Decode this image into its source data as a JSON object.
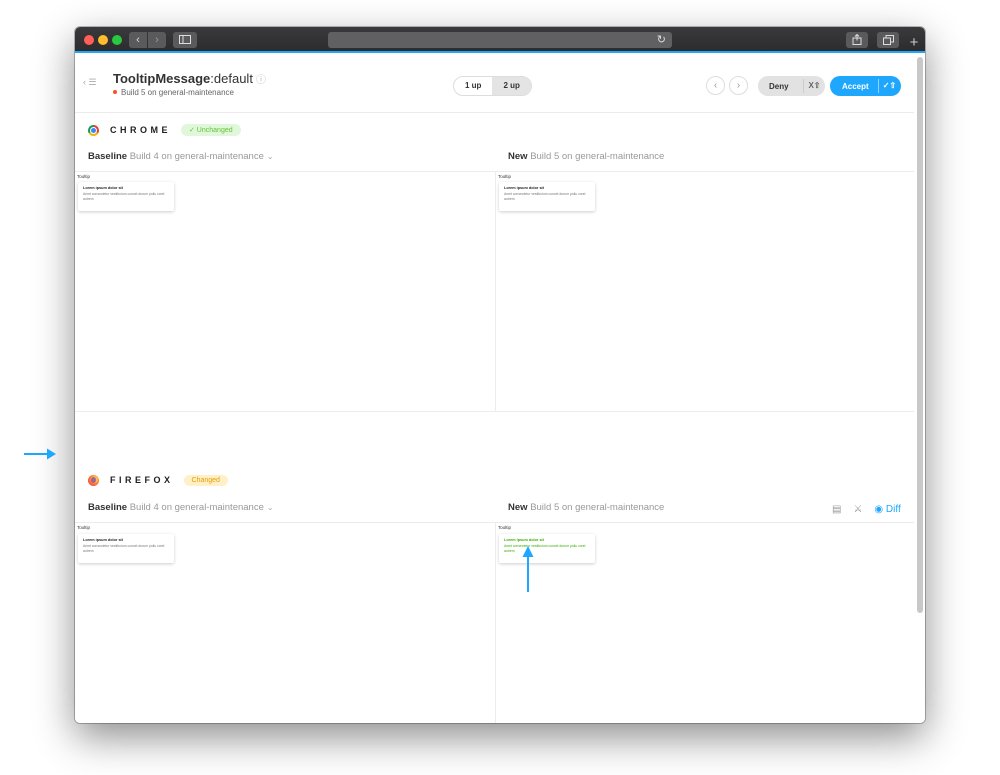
{
  "toolbar": {
    "back_icon": "‹",
    "forward_icon": "›",
    "reload_icon": "↻",
    "plus_icon": "+"
  },
  "header": {
    "menu_icon": "‹ ☰",
    "story_component": "TooltipMessage",
    "story_name": ":default",
    "info_icon": "ⓘ",
    "build_info": "Build 5 on general-maintenance",
    "view_modes": [
      "1 up",
      "2 up"
    ],
    "prev_icon": "‹",
    "next_icon": "›",
    "deny_label": "Deny",
    "deny_shortcut": "X⇧",
    "accept_label": "Accept",
    "accept_shortcut": "✓⇧"
  },
  "chrome": {
    "name": "CHROME",
    "status": "✓ Unchanged",
    "baseline_label": "Baseline",
    "baseline_build": "Build 4 on general-maintenance",
    "new_label": "New",
    "new_build": "Build 5 on general-maintenance",
    "chevron": "⌄",
    "snapshot_title": "Tooltip",
    "tip_title": "Lorem ipsum dolor sit",
    "tip_body": "Amet consectetur vestibulum concet durum pollu corel autrem"
  },
  "firefox": {
    "name": "FIREFOX",
    "status": "Changed",
    "baseline_label": "Baseline",
    "baseline_build": "Build 4 on general-maintenance",
    "new_label": "New",
    "new_build": "Build 5 on general-maintenance",
    "chevron": "⌄",
    "snapshot_title": "Tooltip",
    "tip_title": "Lorem ipsum dolor sit",
    "tip_body": "Amet consectetur vestibulum concet durum pollu corel autrem",
    "tools": {
      "copy_icon": "▤",
      "strike_icon": "⚔",
      "diff_label": "◉ Diff"
    }
  },
  "colors": {
    "accent": "#1ea7fd",
    "unchanged": "#66bf3c",
    "changed": "#e69d00",
    "diff": "#38b000"
  }
}
